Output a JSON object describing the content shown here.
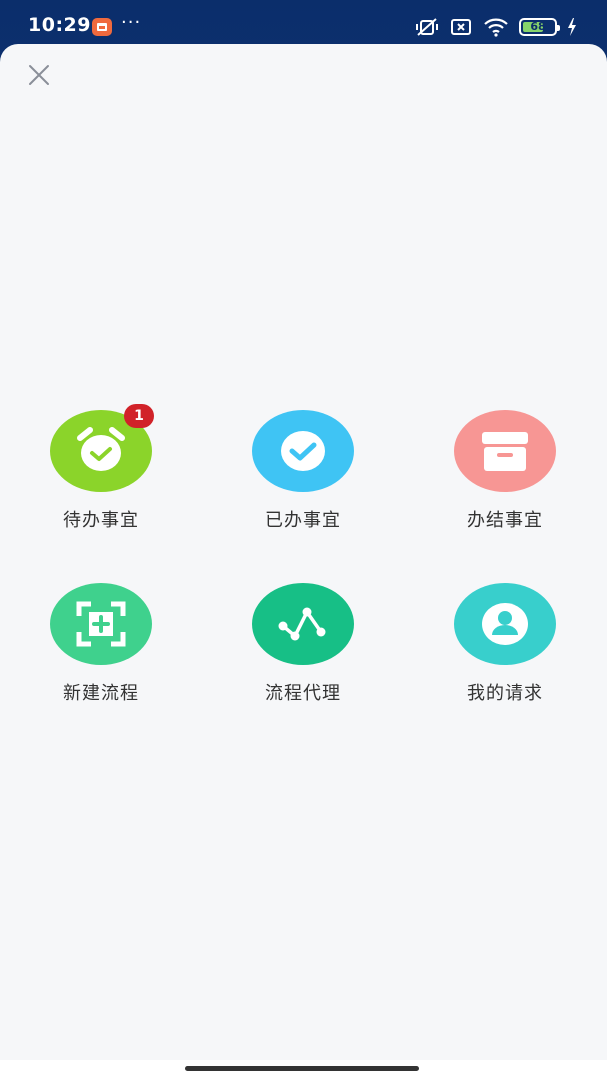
{
  "status_bar": {
    "time": "10:29",
    "more": "···",
    "battery_level": "68",
    "battery_fraction": 0.68
  },
  "colors": {
    "sheet_bg": "#f6f7f9",
    "todo_green": "#8bd42a",
    "done_blue": "#3fc4f4",
    "finished_pink": "#f79694",
    "new_process_green": "#3fd18d",
    "agent_green": "#17bf86",
    "my_request_teal": "#38cfcc",
    "badge_red": "#d12229"
  },
  "menu": {
    "items": [
      {
        "label": "待办事宜",
        "icon": "alarm-clock-check-icon",
        "badge": "1"
      },
      {
        "label": "已办事宜",
        "icon": "check-icon"
      },
      {
        "label": "办结事宜",
        "icon": "archive-box-icon"
      },
      {
        "label": "新建流程",
        "icon": "add-frame-icon"
      },
      {
        "label": "流程代理",
        "icon": "flow-line-icon"
      },
      {
        "label": "我的请求",
        "icon": "user-avatar-icon"
      }
    ]
  }
}
